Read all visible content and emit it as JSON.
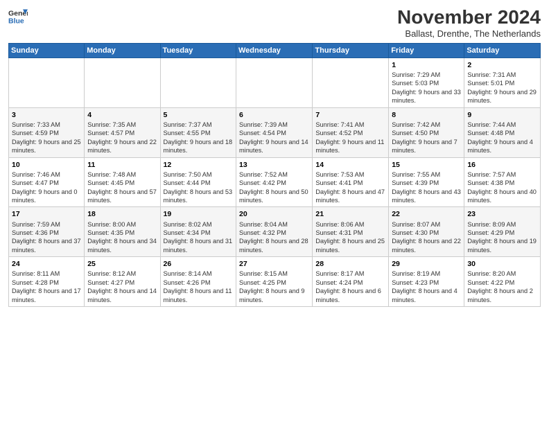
{
  "logo": {
    "general": "General",
    "blue": "Blue"
  },
  "header": {
    "month": "November 2024",
    "location": "Ballast, Drenthe, The Netherlands"
  },
  "weekdays": [
    "Sunday",
    "Monday",
    "Tuesday",
    "Wednesday",
    "Thursday",
    "Friday",
    "Saturday"
  ],
  "weeks": [
    [
      {
        "day": "",
        "info": ""
      },
      {
        "day": "",
        "info": ""
      },
      {
        "day": "",
        "info": ""
      },
      {
        "day": "",
        "info": ""
      },
      {
        "day": "",
        "info": ""
      },
      {
        "day": "1",
        "info": "Sunrise: 7:29 AM\nSunset: 5:03 PM\nDaylight: 9 hours and 33 minutes."
      },
      {
        "day": "2",
        "info": "Sunrise: 7:31 AM\nSunset: 5:01 PM\nDaylight: 9 hours and 29 minutes."
      }
    ],
    [
      {
        "day": "3",
        "info": "Sunrise: 7:33 AM\nSunset: 4:59 PM\nDaylight: 9 hours and 25 minutes."
      },
      {
        "day": "4",
        "info": "Sunrise: 7:35 AM\nSunset: 4:57 PM\nDaylight: 9 hours and 22 minutes."
      },
      {
        "day": "5",
        "info": "Sunrise: 7:37 AM\nSunset: 4:55 PM\nDaylight: 9 hours and 18 minutes."
      },
      {
        "day": "6",
        "info": "Sunrise: 7:39 AM\nSunset: 4:54 PM\nDaylight: 9 hours and 14 minutes."
      },
      {
        "day": "7",
        "info": "Sunrise: 7:41 AM\nSunset: 4:52 PM\nDaylight: 9 hours and 11 minutes."
      },
      {
        "day": "8",
        "info": "Sunrise: 7:42 AM\nSunset: 4:50 PM\nDaylight: 9 hours and 7 minutes."
      },
      {
        "day": "9",
        "info": "Sunrise: 7:44 AM\nSunset: 4:48 PM\nDaylight: 9 hours and 4 minutes."
      }
    ],
    [
      {
        "day": "10",
        "info": "Sunrise: 7:46 AM\nSunset: 4:47 PM\nDaylight: 9 hours and 0 minutes."
      },
      {
        "day": "11",
        "info": "Sunrise: 7:48 AM\nSunset: 4:45 PM\nDaylight: 8 hours and 57 minutes."
      },
      {
        "day": "12",
        "info": "Sunrise: 7:50 AM\nSunset: 4:44 PM\nDaylight: 8 hours and 53 minutes."
      },
      {
        "day": "13",
        "info": "Sunrise: 7:52 AM\nSunset: 4:42 PM\nDaylight: 8 hours and 50 minutes."
      },
      {
        "day": "14",
        "info": "Sunrise: 7:53 AM\nSunset: 4:41 PM\nDaylight: 8 hours and 47 minutes."
      },
      {
        "day": "15",
        "info": "Sunrise: 7:55 AM\nSunset: 4:39 PM\nDaylight: 8 hours and 43 minutes."
      },
      {
        "day": "16",
        "info": "Sunrise: 7:57 AM\nSunset: 4:38 PM\nDaylight: 8 hours and 40 minutes."
      }
    ],
    [
      {
        "day": "17",
        "info": "Sunrise: 7:59 AM\nSunset: 4:36 PM\nDaylight: 8 hours and 37 minutes."
      },
      {
        "day": "18",
        "info": "Sunrise: 8:00 AM\nSunset: 4:35 PM\nDaylight: 8 hours and 34 minutes."
      },
      {
        "day": "19",
        "info": "Sunrise: 8:02 AM\nSunset: 4:34 PM\nDaylight: 8 hours and 31 minutes."
      },
      {
        "day": "20",
        "info": "Sunrise: 8:04 AM\nSunset: 4:32 PM\nDaylight: 8 hours and 28 minutes."
      },
      {
        "day": "21",
        "info": "Sunrise: 8:06 AM\nSunset: 4:31 PM\nDaylight: 8 hours and 25 minutes."
      },
      {
        "day": "22",
        "info": "Sunrise: 8:07 AM\nSunset: 4:30 PM\nDaylight: 8 hours and 22 minutes."
      },
      {
        "day": "23",
        "info": "Sunrise: 8:09 AM\nSunset: 4:29 PM\nDaylight: 8 hours and 19 minutes."
      }
    ],
    [
      {
        "day": "24",
        "info": "Sunrise: 8:11 AM\nSunset: 4:28 PM\nDaylight: 8 hours and 17 minutes."
      },
      {
        "day": "25",
        "info": "Sunrise: 8:12 AM\nSunset: 4:27 PM\nDaylight: 8 hours and 14 minutes."
      },
      {
        "day": "26",
        "info": "Sunrise: 8:14 AM\nSunset: 4:26 PM\nDaylight: 8 hours and 11 minutes."
      },
      {
        "day": "27",
        "info": "Sunrise: 8:15 AM\nSunset: 4:25 PM\nDaylight: 8 hours and 9 minutes."
      },
      {
        "day": "28",
        "info": "Sunrise: 8:17 AM\nSunset: 4:24 PM\nDaylight: 8 hours and 6 minutes."
      },
      {
        "day": "29",
        "info": "Sunrise: 8:19 AM\nSunset: 4:23 PM\nDaylight: 8 hours and 4 minutes."
      },
      {
        "day": "30",
        "info": "Sunrise: 8:20 AM\nSunset: 4:22 PM\nDaylight: 8 hours and 2 minutes."
      }
    ]
  ]
}
